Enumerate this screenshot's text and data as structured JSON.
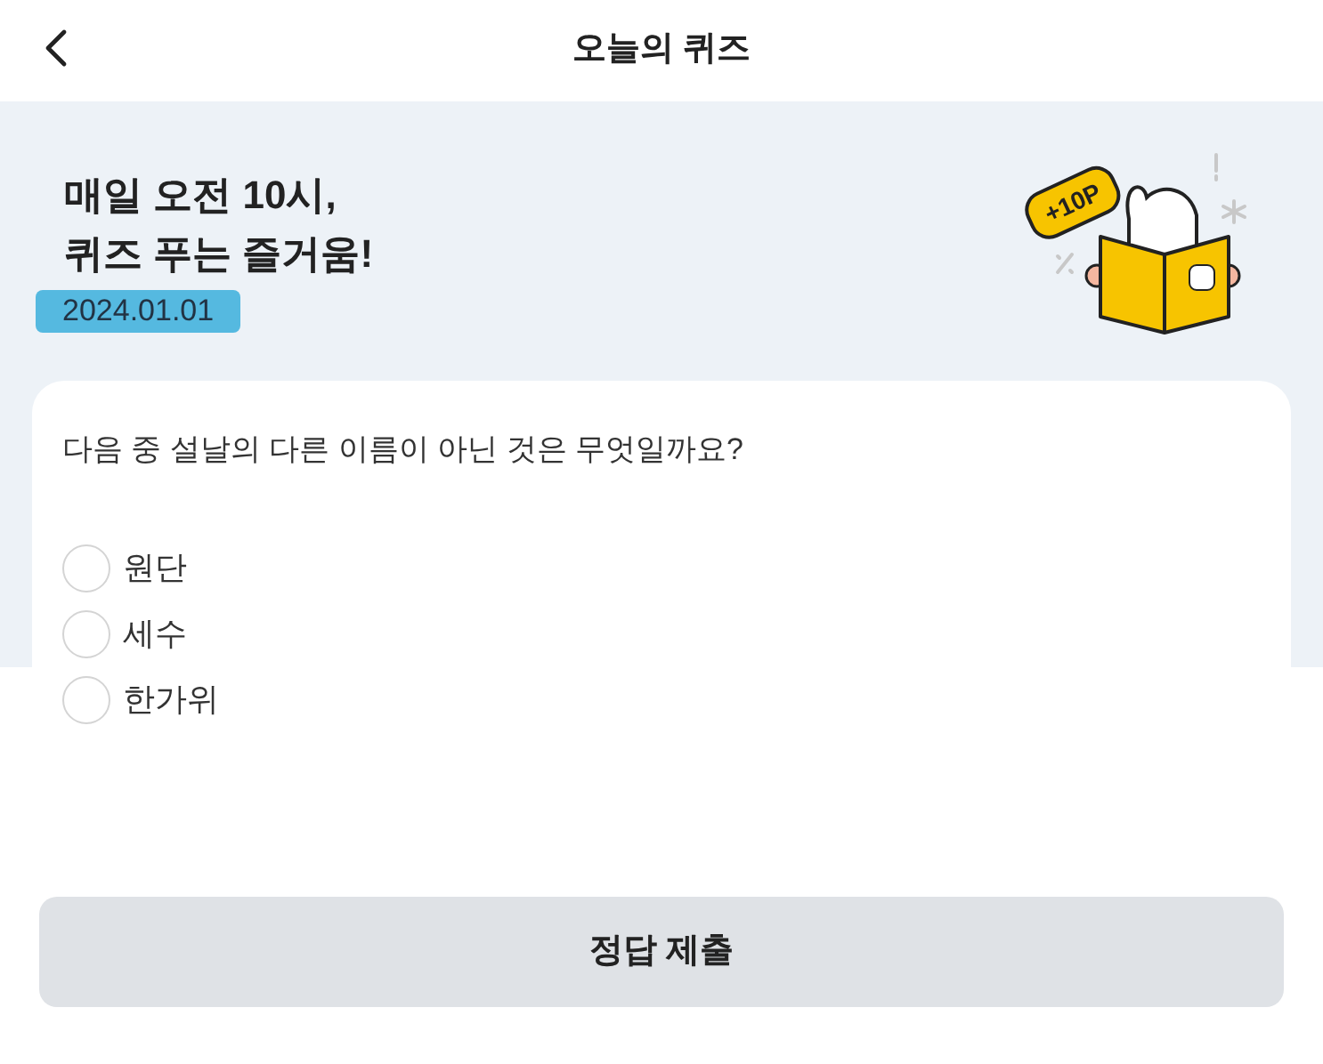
{
  "header": {
    "title": "오늘의 퀴즈"
  },
  "hero": {
    "headline_lines": [
      "매일 오전 10시,",
      "퀴즈 푸는 즐거움!"
    ],
    "date": "2024.01.01",
    "reward_badge": "+10P"
  },
  "quiz": {
    "question": "다음 중 설날의 다른 이름이 아닌 것은 무엇일까요?",
    "options": [
      {
        "label": "원단",
        "selected": false
      },
      {
        "label": "세수",
        "selected": false
      },
      {
        "label": "한가위",
        "selected": false
      }
    ]
  },
  "submit_button": "정답 제출"
}
